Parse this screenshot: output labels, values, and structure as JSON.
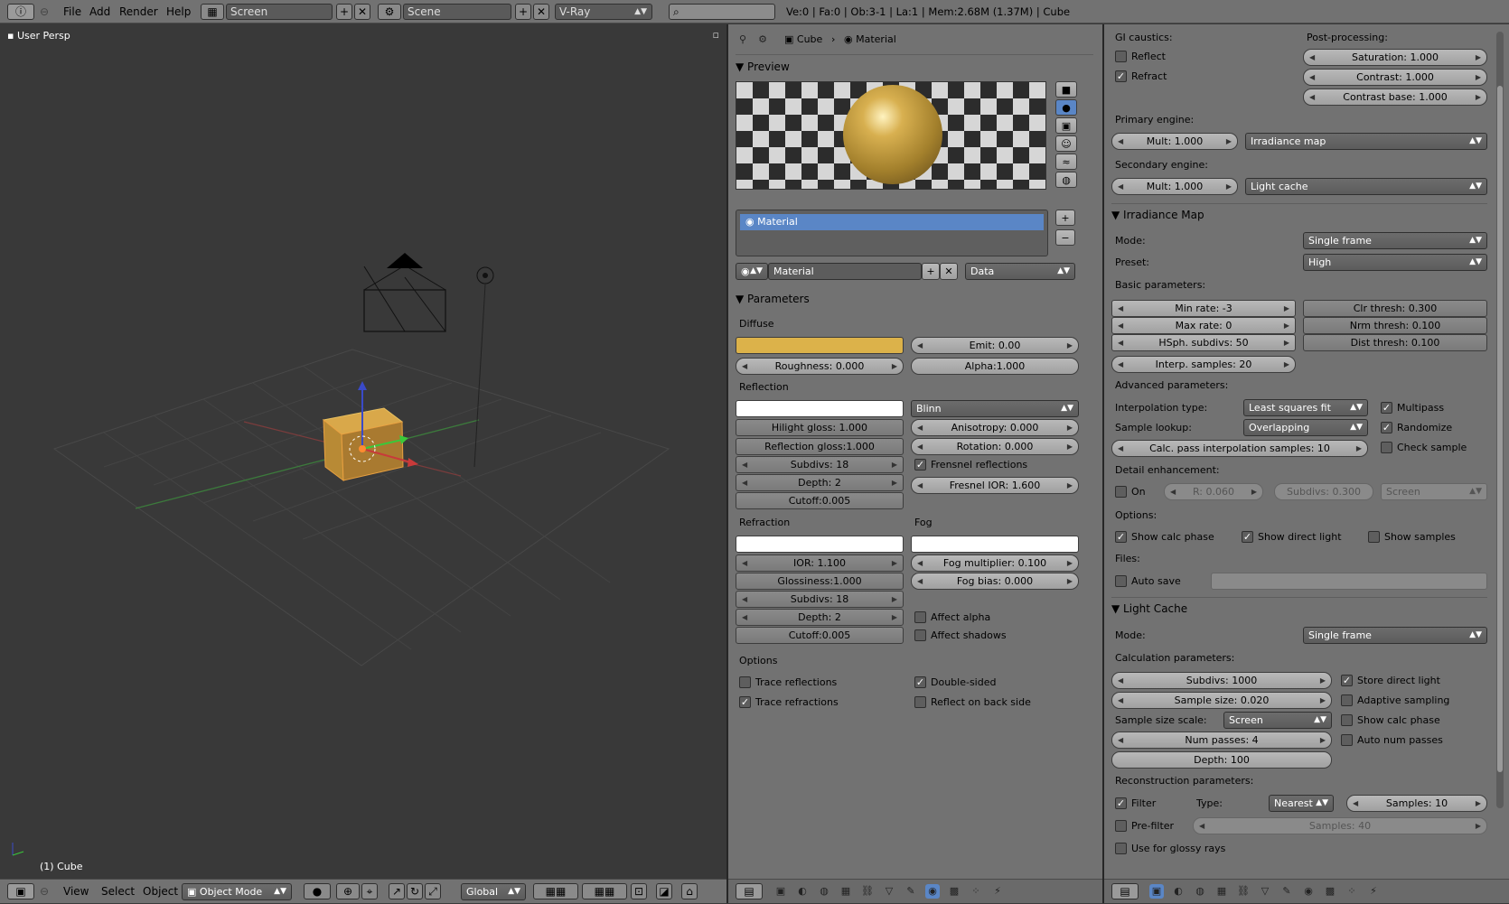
{
  "topbar": {
    "menu": [
      "File",
      "Add",
      "Render",
      "Help"
    ],
    "screen": "Screen",
    "scene": "Scene",
    "engine": "V-Ray",
    "stats": "Ve:0 | Fa:0 | Ob:3-1 | La:1 | Mem:2.68M (1.37M) | Cube"
  },
  "viewport": {
    "view_label": "User Persp",
    "object_label": "(1) Cube",
    "footer": {
      "view": "View",
      "select": "Select",
      "object": "Object",
      "mode": "Object Mode",
      "orientation": "Global"
    }
  },
  "props": {
    "breadcrumb": {
      "object": "Cube",
      "material": "Material"
    },
    "preview": {
      "title": "Preview"
    },
    "material_slot": "Material",
    "material_name": "Material",
    "data_select": "Data",
    "parameters": {
      "title": "Parameters",
      "diffuse": {
        "label": "Diffuse",
        "emit": "Emit: 0.00",
        "roughness": "Roughness: 0.000",
        "alpha": "Alpha:1.000",
        "color": "#dcb24a"
      },
      "reflection": {
        "label": "Reflection",
        "brdf": "Blinn",
        "hilight": "Hilight gloss: 1.000",
        "aniso": "Anisotropy: 0.000",
        "refl_gloss": "Reflection gloss:1.000",
        "rotation": "Rotation: 0.000",
        "subdivs": "Subdivs: 18",
        "fresnel": "Frensnel reflections",
        "depth": "Depth: 2",
        "fresnel_ior": "Fresnel IOR: 1.600",
        "cutoff": "Cutoff:0.005"
      },
      "refraction": {
        "label": "Refraction",
        "ior": "IOR: 1.100",
        "gloss": "Glossiness:1.000",
        "subdivs": "Subdivs: 18",
        "depth": "Depth: 2",
        "cutoff": "Cutoff:0.005"
      },
      "fog": {
        "label": "Fog",
        "multiplier": "Fog multiplier: 0.100",
        "bias": "Fog bias: 0.000",
        "affect_alpha": "Affect alpha",
        "affect_shadows": "Affect shadows"
      },
      "options": {
        "label": "Options",
        "trace_refl": "Trace reflections",
        "trace_refr": "Trace refractions",
        "double_sided": "Double-sided",
        "reflect_back": "Reflect on back side"
      }
    }
  },
  "gi": {
    "caustics": {
      "label": "GI caustics:",
      "reflect": "Reflect",
      "refract": "Refract"
    },
    "post": {
      "label": "Post-processing:",
      "saturation": "Saturation: 1.000",
      "contrast": "Contrast: 1.000",
      "contrast_base": "Contrast base: 1.000"
    },
    "primary": {
      "label": "Primary engine:",
      "mult": "Mult: 1.000",
      "engine": "Irradiance map"
    },
    "secondary": {
      "label": "Secondary engine:",
      "mult": "Mult: 1.000",
      "engine": "Light cache"
    },
    "irr": {
      "title": "Irradiance Map",
      "mode_label": "Mode:",
      "mode": "Single frame",
      "preset_label": "Preset:",
      "preset": "High",
      "basic": "Basic parameters:",
      "min_rate": "Min rate: -3",
      "max_rate": "Max rate: 0",
      "hsph": "HSph. subdivs: 50",
      "interp": "Interp. samples: 20",
      "clr": "Clr thresh: 0.300",
      "nrm": "Nrm thresh: 0.100",
      "dist": "Dist thresh: 0.100",
      "advanced": "Advanced parameters:",
      "interp_type_label": "Interpolation type:",
      "interp_type": "Least squares fit",
      "sample_lookup_label": "Sample lookup:",
      "sample_lookup": "Overlapping",
      "calc_pass": "Calc. pass interpolation samples: 10",
      "multipass": "Multipass",
      "randomize": "Randomize",
      "check_sample": "Check sample",
      "detail": "Detail enhancement:",
      "on": "On",
      "r": "R: 0.060",
      "subdivs": "Subdivs: 0.300",
      "screen": "Screen",
      "options": "Options:",
      "show_calc": "Show calc phase",
      "show_direct": "Show direct light",
      "show_samples": "Show samples",
      "files": "Files:",
      "auto_save": "Auto save"
    },
    "lc": {
      "title": "Light Cache",
      "mode_label": "Mode:",
      "mode": "Single frame",
      "calc": "Calculation parameters:",
      "subdivs": "Subdivs: 1000",
      "sample_size": "Sample size: 0.020",
      "scale_label": "Sample size scale:",
      "scale": "Screen",
      "num_passes": "Num passes: 4",
      "depth": "Depth: 100",
      "store_direct": "Store direct light",
      "adaptive": "Adaptive sampling",
      "show_calc": "Show calc phase",
      "auto_num": "Auto num passes",
      "recon": "Reconstruction parameters:",
      "filter": "Filter",
      "type_label": "Type:",
      "type": "Nearest",
      "samples": "Samples: 10",
      "prefilter": "Pre-filter",
      "pre_samples": "Samples: 40",
      "glossy": "Use for glossy rays"
    }
  }
}
